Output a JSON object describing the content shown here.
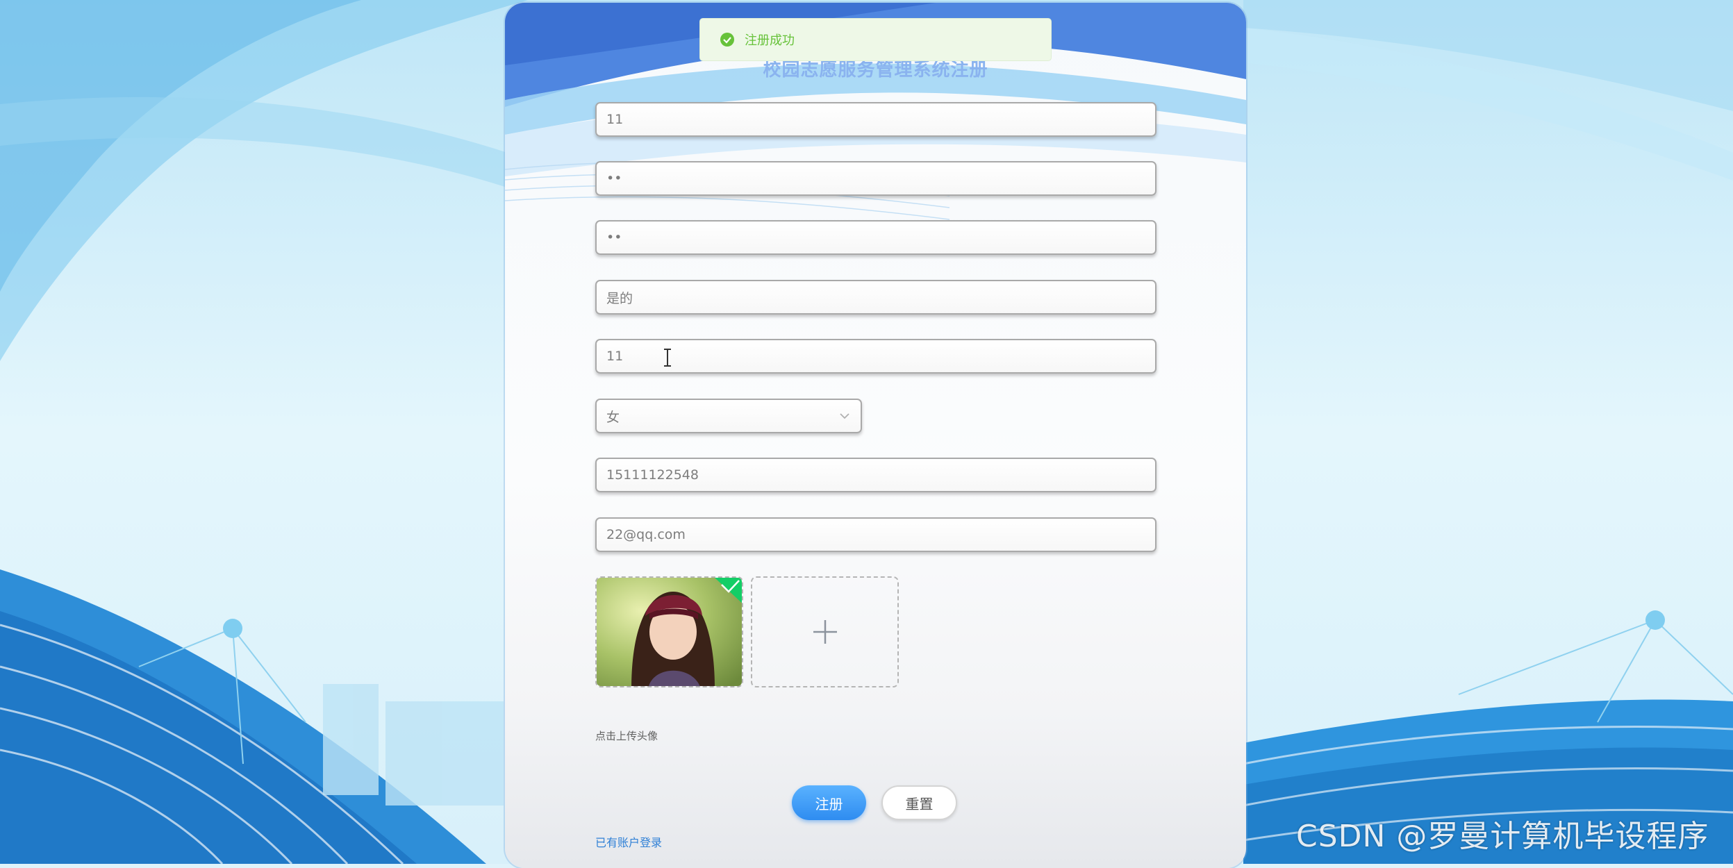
{
  "page": {
    "title": "校园志愿服务管理系统注册"
  },
  "form": {
    "fields": [
      {
        "value": "11"
      },
      {
        "value": "••"
      },
      {
        "value": "••"
      },
      {
        "value": "是的"
      },
      {
        "value": "11"
      },
      {
        "value": "女",
        "type": "select"
      },
      {
        "value": "15111122548"
      },
      {
        "value": "22@qq.com"
      }
    ],
    "upload_tip": "点击上传头像",
    "register_label": "注册",
    "reset_label": "重置",
    "login_link": "已有账户登录"
  },
  "toast": {
    "message": "注册成功",
    "status_color": "#67c23a"
  },
  "watermark": "CSDN @罗曼计算机毕设程序",
  "colors": {
    "primary": "#409eff",
    "success": "#67c23a"
  }
}
